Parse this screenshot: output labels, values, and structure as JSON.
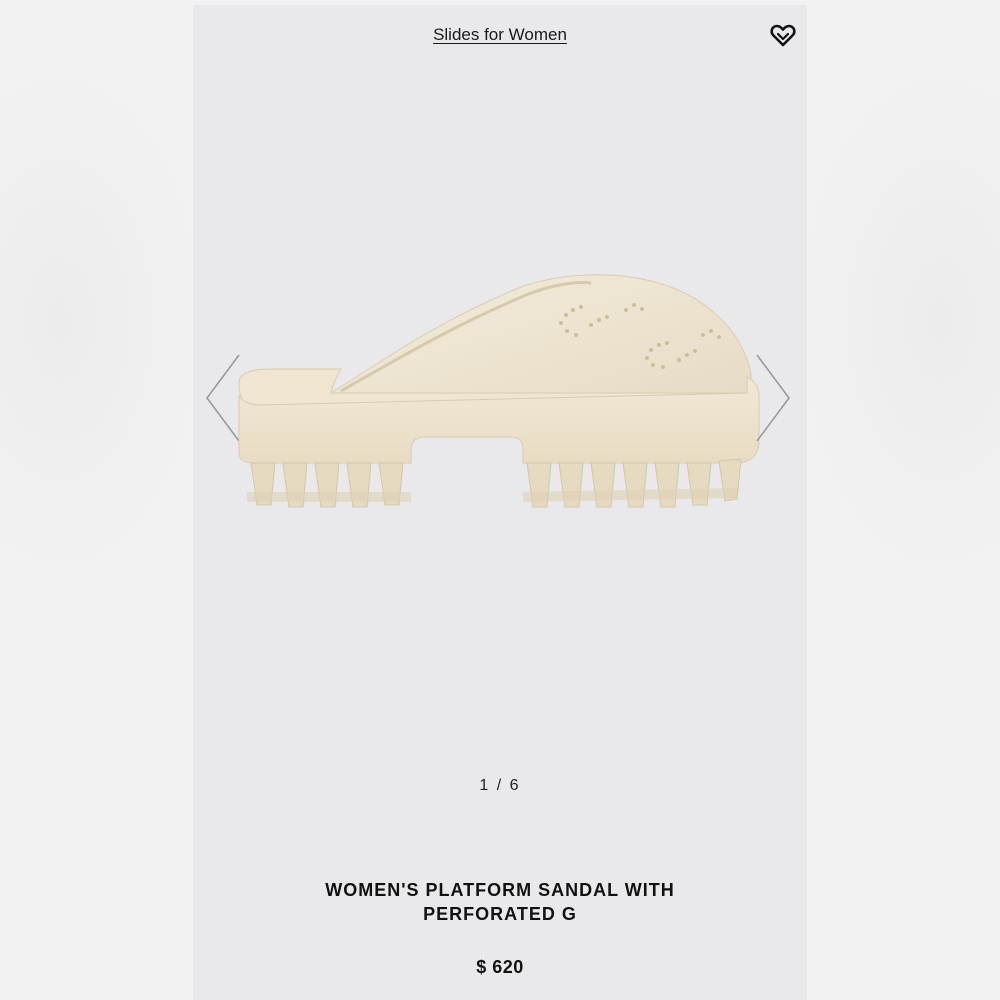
{
  "header": {
    "category_link": "Slides for Women"
  },
  "gallery": {
    "pager": "1 / 6"
  },
  "product": {
    "name_line1": "WOMEN'S PLATFORM SANDAL WITH",
    "name_line2": "PERFORATED G",
    "price": "$ 620"
  },
  "colors": {
    "product": "#efe6d3",
    "screen_bg": "#e9e9eb",
    "text": "#111111"
  },
  "icons": {
    "favorite": "heart-icon",
    "prev": "chevron-left-icon",
    "next": "chevron-right-icon"
  }
}
